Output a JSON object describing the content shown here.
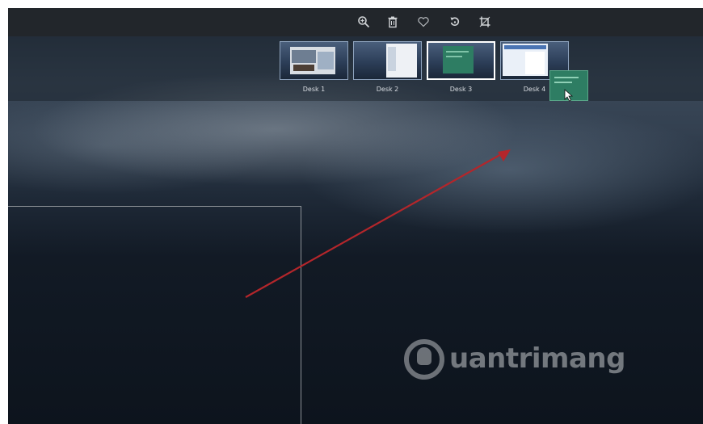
{
  "toolbar": {
    "icons": [
      "zoom-in-icon",
      "trash-icon",
      "heart-icon",
      "rotate-icon",
      "crop-icon"
    ]
  },
  "desks": [
    {
      "label": "Desk 1",
      "active": false
    },
    {
      "label": "Desk 2",
      "active": false
    },
    {
      "label": "Desk 3",
      "active": true
    },
    {
      "label": "Desk 4",
      "active": false
    }
  ],
  "watermark": {
    "text": "uantrimang"
  },
  "colors": {
    "toolbar_bg": "#22262b",
    "arrow": "#b3262b",
    "window_green": "#2e7d63",
    "active_border": "#ffffff"
  }
}
